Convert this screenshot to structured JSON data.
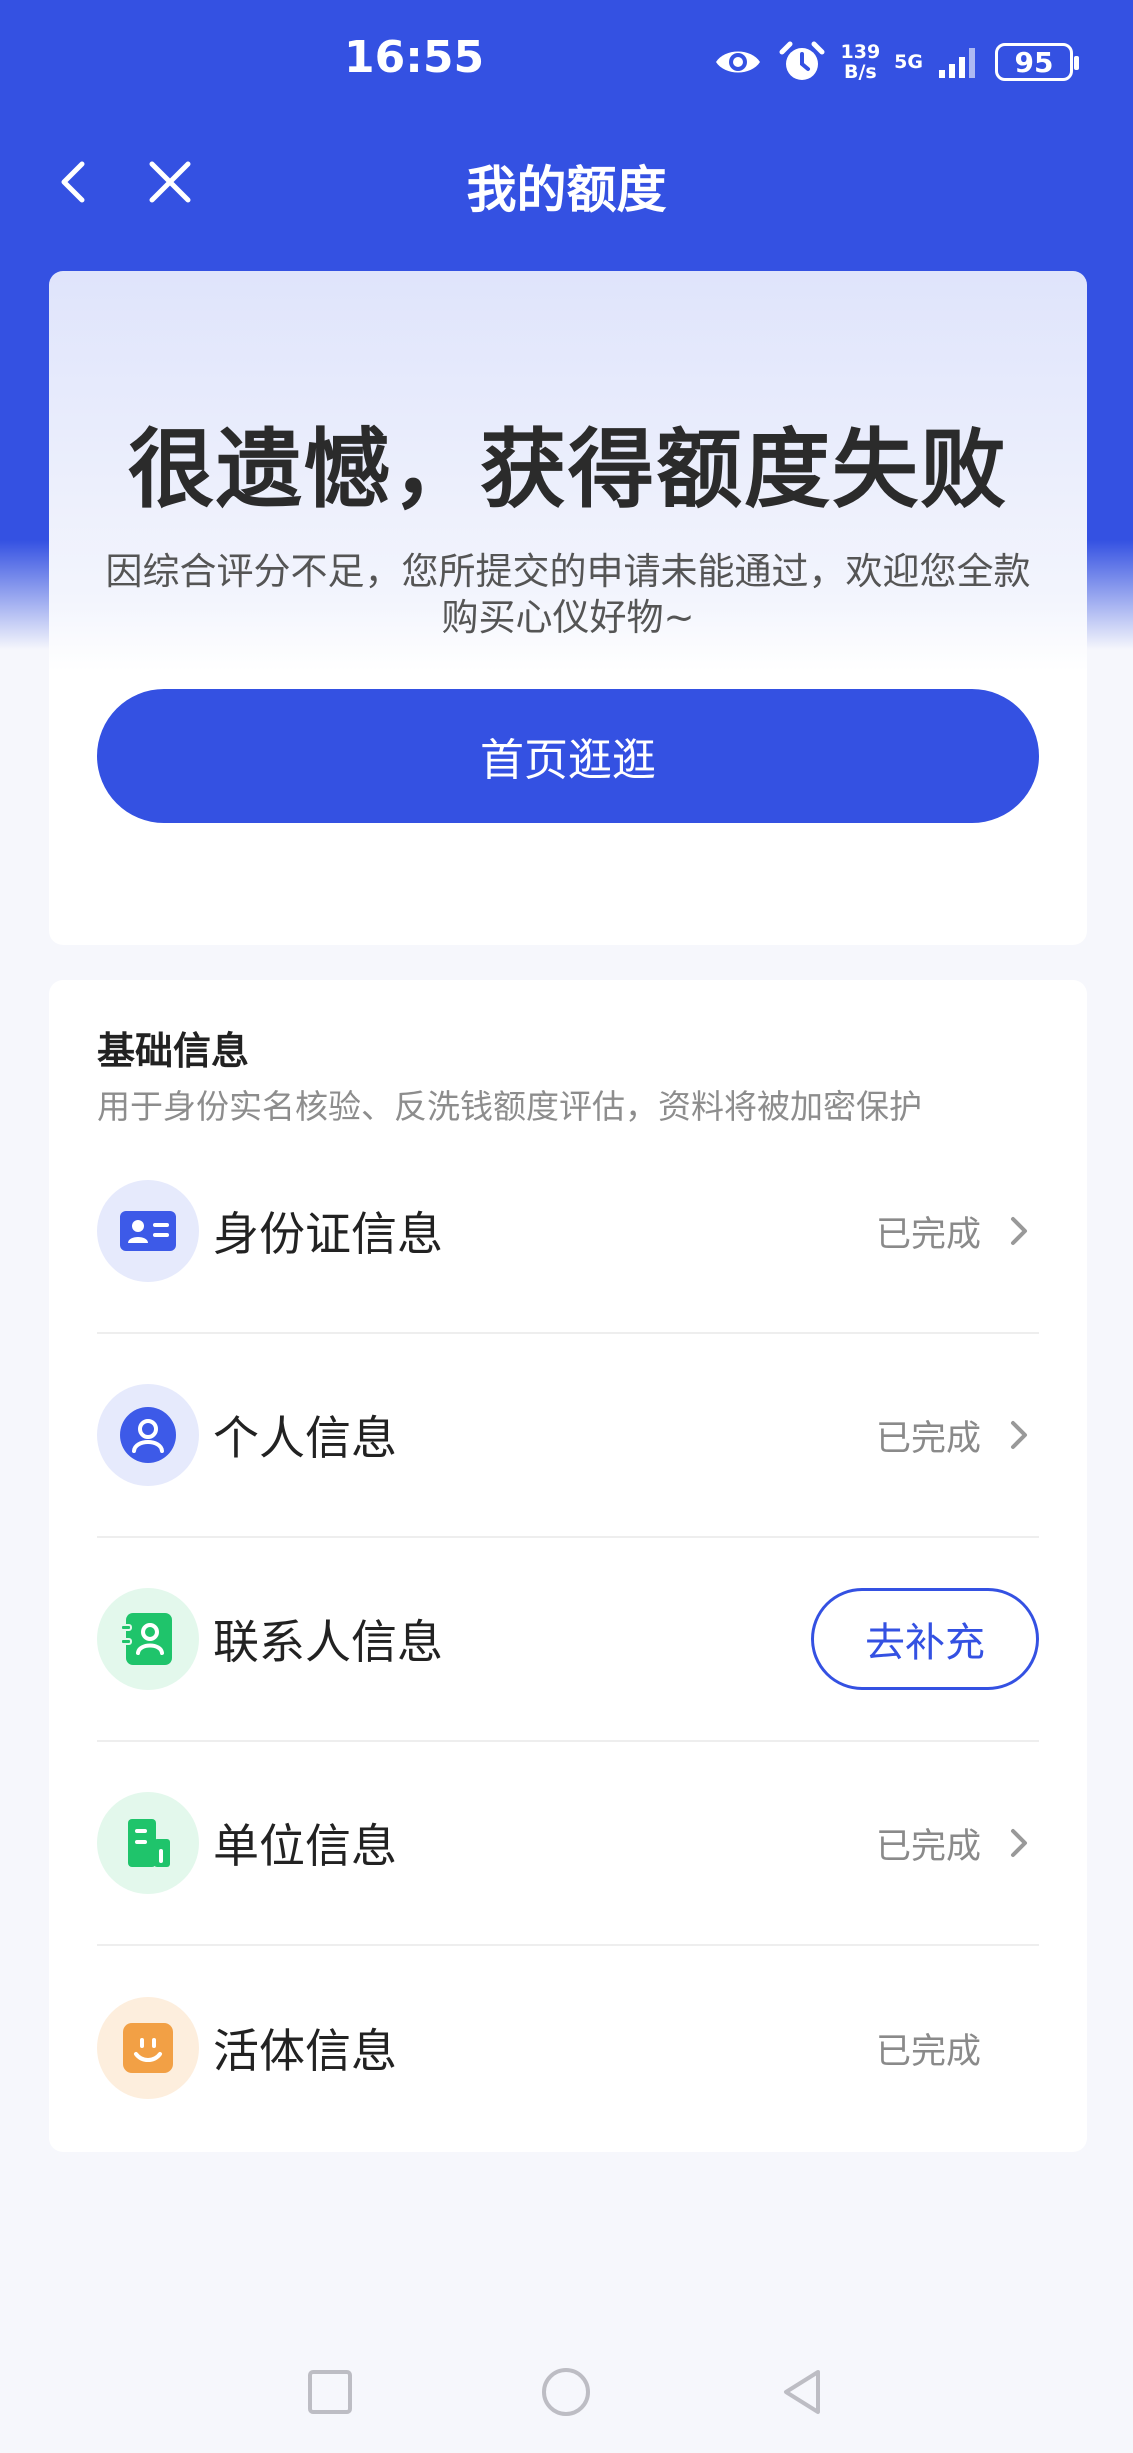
{
  "status_bar": {
    "time": "16:55",
    "net_speed_value": "139",
    "net_speed_unit": "B/s",
    "network": "5G",
    "battery": "95"
  },
  "nav": {
    "title": "我的额度"
  },
  "result": {
    "title": "很遗憾，获得额度失败",
    "description": "因综合评分不足，您所提交的申请未能通过，欢迎您全款购买心仪好物~",
    "button_label": "首页逛逛"
  },
  "info": {
    "title": "基础信息",
    "subtitle": "用于身份实名核验、反洗钱额度评估，资料将被加密保护",
    "items": [
      {
        "label": "身份证信息",
        "status": "已完成",
        "icon": "id-card-icon"
      },
      {
        "label": "个人信息",
        "status": "已完成",
        "icon": "person-icon"
      },
      {
        "label": "联系人信息",
        "action": "去补充",
        "icon": "contacts-icon"
      },
      {
        "label": "单位信息",
        "status": "已完成",
        "icon": "building-icon"
      },
      {
        "label": "活体信息",
        "status": "已完成",
        "icon": "face-icon"
      }
    ]
  },
  "colors": {
    "primary": "#3451e2",
    "id_icon_bg": "#e6eafc",
    "contact_icon": "#1fc46b",
    "face_icon": "#f2a045"
  }
}
